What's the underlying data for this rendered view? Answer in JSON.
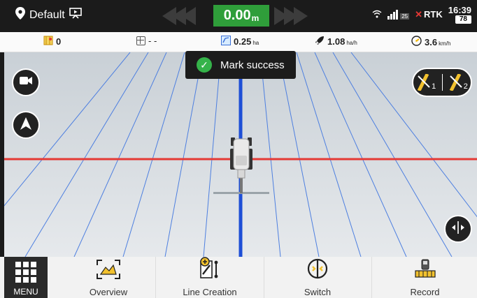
{
  "topbar": {
    "profile_name": "Default",
    "speed_value": "0.00",
    "speed_unit": "m",
    "sim_badge": "25",
    "rtk_label": "RTK",
    "time": "16:39",
    "battery": "78"
  },
  "infobar": {
    "count": "0",
    "area_placeholder": "- -",
    "worked_area": "0.25",
    "worked_area_unit": "ha",
    "efficiency": "1.08",
    "efficiency_unit": "ha/h",
    "speed": "3.6",
    "speed_unit": "km/h"
  },
  "toast": {
    "message": "Mark success"
  },
  "ab_buttons": {
    "a": "1",
    "b": "2"
  },
  "bottombar": {
    "menu_label": "MENU",
    "items": [
      {
        "label": "Overview"
      },
      {
        "label": "Line Creation"
      },
      {
        "label": "Switch"
      },
      {
        "label": "Record"
      }
    ]
  },
  "colors": {
    "speed_green": "#2f9e3a",
    "guide_blue": "#1e4fd6",
    "boundary_red": "#e53935",
    "check_green": "#35b34a"
  }
}
